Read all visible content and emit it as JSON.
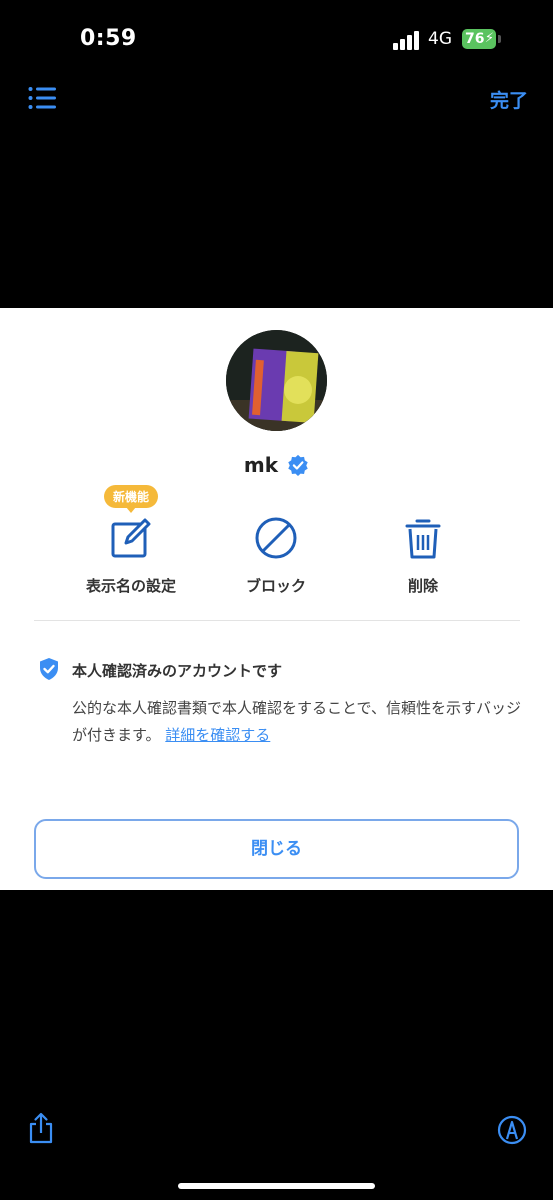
{
  "status_bar": {
    "time": "0:59",
    "network": "4G",
    "battery": "76",
    "icons": [
      "signal-icon",
      "battery-icon"
    ]
  },
  "toolbar": {
    "done_label": "完了",
    "icons": [
      "list-icon",
      "share-icon",
      "markup-icon"
    ]
  },
  "profile": {
    "username": "mk",
    "verified_icon": "verified-badge-icon"
  },
  "actions": [
    {
      "label": "表示名の設定",
      "icon": "edit-icon",
      "badge": "新機能"
    },
    {
      "label": "ブロック",
      "icon": "block-icon"
    },
    {
      "label": "削除",
      "icon": "trash-icon"
    }
  ],
  "verification": {
    "title": "本人確認済みのアカウントです",
    "description": "公的な本人確認書類で本人確認をすることで、信頼性を示すバッジが付きます。",
    "link_text": "詳細を確認する"
  },
  "close_button": "閉じる",
  "colors": {
    "accent": "#3b8ef3",
    "badge": "#f5b93a",
    "icon": "#1f5fb8"
  }
}
